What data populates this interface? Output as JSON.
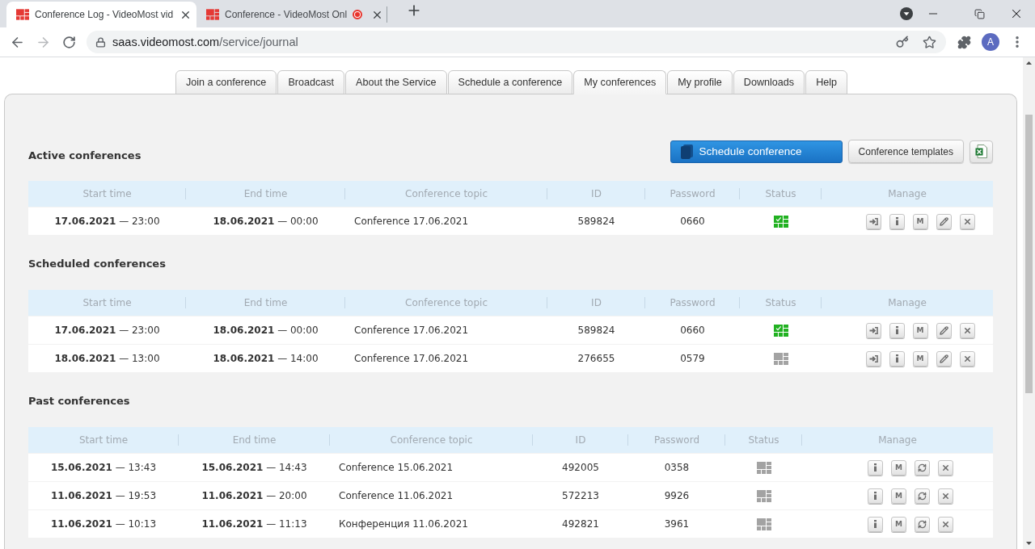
{
  "browser": {
    "tabs": [
      {
        "title": "Conference Log - VideoMost vid",
        "selected": true,
        "recording": false
      },
      {
        "title": "Conference - VideoMost Onl",
        "selected": false,
        "recording": true
      }
    ],
    "address": {
      "host": "saas.videomost.com",
      "path": "/service/journal"
    },
    "profile": "A"
  },
  "nav": {
    "tabs": [
      {
        "label": "Join a conference",
        "selected": false
      },
      {
        "label": "Broadcast",
        "selected": false
      },
      {
        "label": "About the Service",
        "selected": false
      },
      {
        "label": "Schedule a conference",
        "selected": false
      },
      {
        "label": "My conferences",
        "selected": true
      },
      {
        "label": "My profile",
        "selected": false
      },
      {
        "label": "Downloads",
        "selected": false
      },
      {
        "label": "Help",
        "selected": false
      }
    ]
  },
  "toolbar": {
    "schedule_button": "Schedule conference",
    "templates_button": "Conference templates"
  },
  "sections": [
    {
      "kind": "active",
      "title": "Active conferences",
      "columns": [
        "Start time",
        "End time",
        "Conference topic",
        "ID",
        "Password",
        "Status",
        "Manage"
      ],
      "rows": [
        {
          "start": "**17.06.2021** — 23:00",
          "end": "**18.06.2021** — 00:00",
          "topic": "Conference 17.06.2021",
          "id": "589824",
          "password": "0660",
          "active": true,
          "actions": [
            {
              "kind": "join"
            },
            {
              "kind": "info"
            },
            {
              "kind": "letter",
              "label": "M"
            },
            {
              "kind": "edit"
            },
            {
              "kind": "delete"
            }
          ]
        }
      ]
    },
    {
      "kind": "scheduled",
      "title": "Scheduled conferences",
      "columns": [
        "Start time",
        "End time",
        "Conference topic",
        "ID",
        "Password",
        "Status",
        "Manage"
      ],
      "rows": [
        {
          "start": "**17.06.2021** — 23:00",
          "end": "**18.06.2021** — 00:00",
          "topic": "Conference 17.06.2021",
          "id": "589824",
          "password": "0660",
          "active": true,
          "actions": [
            {
              "kind": "join"
            },
            {
              "kind": "info"
            },
            {
              "kind": "letter",
              "label": "M"
            },
            {
              "kind": "edit"
            },
            {
              "kind": "delete"
            }
          ]
        },
        {
          "start": "**18.06.2021** — 13:00",
          "end": "**18.06.2021** — 14:00",
          "topic": "Conference 17.06.2021",
          "id": "276655",
          "password": "0579",
          "active": false,
          "actions": [
            {
              "kind": "join"
            },
            {
              "kind": "info"
            },
            {
              "kind": "letter",
              "label": "M"
            },
            {
              "kind": "edit"
            },
            {
              "kind": "delete"
            }
          ]
        }
      ]
    },
    {
      "kind": "past",
      "title": "Past conferences",
      "columns": [
        "Start time",
        "End time",
        "Conference topic",
        "ID",
        "Password",
        "Status",
        "Manage"
      ],
      "rows": [
        {
          "start": "**15.06.2021** — 13:43",
          "end": "**15.06.2021** — 14:43",
          "topic": "Conference 15.06.2021",
          "id": "492005",
          "password": "0358",
          "active": false,
          "actions": [
            {
              "kind": "info"
            },
            {
              "kind": "letter",
              "label": "M"
            },
            {
              "kind": "repeat"
            },
            {
              "kind": "delete"
            }
          ]
        },
        {
          "start": "**11.06.2021** — 19:53",
          "end": "**11.06.2021** — 20:00",
          "topic": "Conference 11.06.2021",
          "id": "572213",
          "password": "9926",
          "active": false,
          "actions": [
            {
              "kind": "info"
            },
            {
              "kind": "letter",
              "label": "M"
            },
            {
              "kind": "repeat"
            },
            {
              "kind": "delete"
            }
          ]
        },
        {
          "start": "**11.06.2021** — 10:13",
          "end": "**11.06.2021** — 11:13",
          "topic": "Конференция 11.06.2021",
          "id": "492821",
          "password": "3961",
          "active": false,
          "actions": [
            {
              "kind": "info"
            },
            {
              "kind": "letter",
              "label": "M"
            },
            {
              "kind": "repeat"
            },
            {
              "kind": "delete"
            }
          ]
        }
      ]
    }
  ]
}
